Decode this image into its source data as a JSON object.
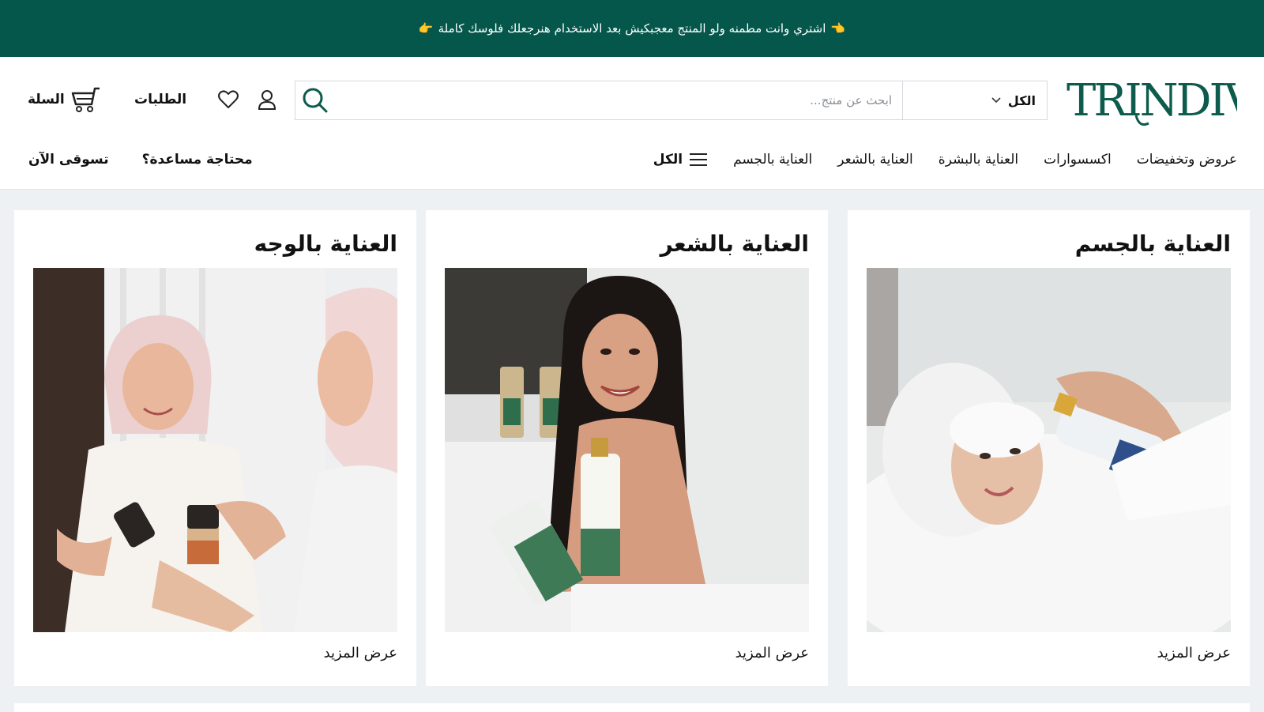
{
  "promo": {
    "text": "اشتري وانت مطمنه ولو المنتج معجبكيش بعد الاستخدام هنرجعلك فلوسك كاملة",
    "emoji_left": "👉",
    "emoji_right": "👈"
  },
  "brand": {
    "logo": "TRINDIVA",
    "color": "#05574b"
  },
  "search": {
    "category": "الكل",
    "placeholder": "ابحث عن منتج..."
  },
  "header": {
    "orders": "الطلبات",
    "cart": "السلة"
  },
  "nav": {
    "all": "الكل",
    "items": [
      "العناية بالجسم",
      "العناية بالشعر",
      "العناية بالبشرة",
      "اكسسوارات",
      "عروض وتخفيضات"
    ],
    "shop_now": "تسوقى الآن",
    "help": "محتاجة مساعدة؟"
  },
  "cards": [
    {
      "title": "العناية بالجسم",
      "more": "عرض المزيد"
    },
    {
      "title": "العناية بالشعر",
      "more": "عرض المزيد"
    },
    {
      "title": "العناية بالوجه",
      "more": "عرض المزيد"
    }
  ]
}
